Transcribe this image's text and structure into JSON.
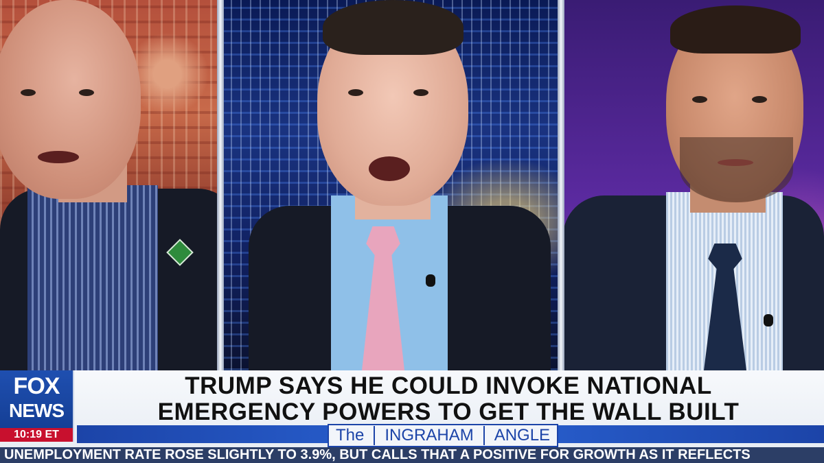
{
  "logo": {
    "line1": "FOX",
    "line2": "NEWS",
    "time": "10:19 ET"
  },
  "headline": {
    "line1": "TRUMP SAYS HE COULD INVOKE NATIONAL",
    "line2": "EMERGENCY POWERS TO GET THE WALL BUILT"
  },
  "show": {
    "word1": "The",
    "word2": "INGRAHAM",
    "word3": "ANGLE"
  },
  "ticker": {
    "text": "UNEMPLOYMENT RATE ROSE SLIGHTLY TO 3.9%, BUT CALLS THAT A POSITIVE FOR GROWTH AS IT REFLECTS"
  },
  "colors": {
    "brand_blue": "#1c44a8",
    "time_red": "#c8102e",
    "ticker_bg": "#2c3e66"
  }
}
